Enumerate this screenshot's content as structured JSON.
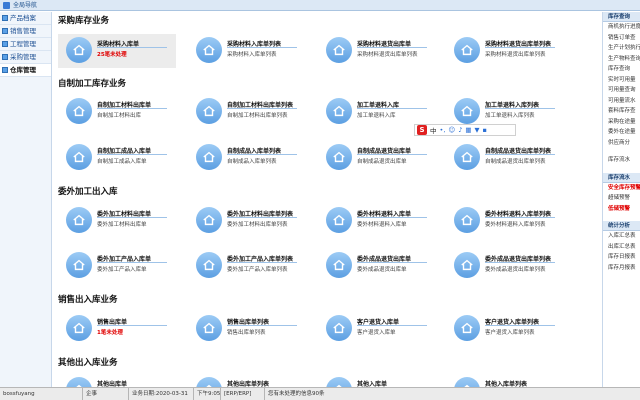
{
  "window": {
    "title": "全局导航"
  },
  "nav": {
    "items": [
      {
        "label": "产品档案"
      },
      {
        "label": "销售管理"
      },
      {
        "label": "工程管理"
      },
      {
        "label": "采购管理"
      },
      {
        "label": "仓库管理"
      }
    ]
  },
  "sections": {
    "purchase": {
      "title": "采购库存业务",
      "cards": [
        {
          "title": "采购材料入库单",
          "sub": "25笔未处理"
        },
        {
          "title": "采购材料入库单列表",
          "sub": "采购材料入库单列表"
        },
        {
          "title": "采购材料退货出库单",
          "sub": "采购材料退货出库单列表"
        },
        {
          "title": "采购材料退货出库单列表",
          "sub": "采购材料退货出库单列表"
        }
      ]
    },
    "selfmade": {
      "title": "自制加工库存业务",
      "cards": [
        {
          "title": "自制加工材料出库单",
          "sub": "自制加工材料出库"
        },
        {
          "title": "自制加工材料出库单列表",
          "sub": "自制加工材料出库单列表"
        },
        {
          "title": "加工单退料入库",
          "sub": "加工单退料入库"
        },
        {
          "title": "加工单退料入库列表",
          "sub": "加工单退料入库列表"
        },
        {
          "title": "自制加工成品入库单",
          "sub": "自制加工成品入库单"
        },
        {
          "title": "自制成品入库单列表",
          "sub": "自制成品入库单列表"
        },
        {
          "title": "自制成品退货出库单",
          "sub": "自制成品退货出库单"
        },
        {
          "title": "自制成品退货出库单列表",
          "sub": "自制成品退货出库单列表"
        }
      ]
    },
    "outsource": {
      "title": "委外加工出入库",
      "cards": [
        {
          "title": "委外加工材料出库单",
          "sub": "委外加工材料出库单"
        },
        {
          "title": "委外加工材料出库单列表",
          "sub": "委外加工材料出库单列表"
        },
        {
          "title": "委外材料退料入库单",
          "sub": "委外材料退料入库单"
        },
        {
          "title": "委外材料退料入库单列表",
          "sub": "委外材料退料入库单列表"
        },
        {
          "title": "委外加工产品入库单",
          "sub": "委外加工产品入库单"
        },
        {
          "title": "委外加工产品入库单列表",
          "sub": "委外加工产品入库单列表"
        },
        {
          "title": "委外成品退货出库单",
          "sub": "委外成品退货出库单"
        },
        {
          "title": "委外成品退货出库单列表",
          "sub": "委外成品退货出库单列表"
        }
      ]
    },
    "sales": {
      "title": "销售出入库业务",
      "cards": [
        {
          "title": "销售出库单",
          "sub": "1笔未处理"
        },
        {
          "title": "销售出库单列表",
          "sub": "销售出库单列表"
        },
        {
          "title": "客户退货入库单",
          "sub": "客户退货入库单"
        },
        {
          "title": "客户退货入库单列表",
          "sub": "客户退货入库单列表"
        }
      ]
    },
    "other": {
      "title": "其他出入库业务",
      "cards": [
        {
          "title": "其他出库单",
          "sub": ""
        },
        {
          "title": "其他出库单列表",
          "sub": ""
        },
        {
          "title": "其他入库单",
          "sub": ""
        },
        {
          "title": "其他入库单列表",
          "sub": ""
        }
      ]
    }
  },
  "right_panel": {
    "query": {
      "title": "库存查询",
      "links": [
        "商机执行进度",
        "销售订单查",
        "生产计划执行",
        "生产物料查询",
        "库存查询",
        "实时可用量",
        "可用量查询",
        "可用量流水",
        "套料库存查",
        "采购在途量",
        "委外在途量",
        "供应商分"
      ]
    },
    "query_extra": {
      "link": "库存流水"
    },
    "flow": {
      "title": "库存流水",
      "links": [
        "安全库存预警",
        "超储预警",
        "低储预警"
      ]
    },
    "stats": {
      "title": "统计分析",
      "links": [
        "入库汇总表",
        "出库汇总表",
        "库存日报表",
        "库存月报表"
      ]
    }
  },
  "statusbar": {
    "user": "bossfuyang",
    "company": "企事",
    "date": "业务日期:2020-03-31",
    "time": "下午9:05",
    "code": "[ERP/ERP]",
    "msg": "您有未处理的信息90条"
  },
  "ime": {
    "logo": "S",
    "mode": "中"
  }
}
